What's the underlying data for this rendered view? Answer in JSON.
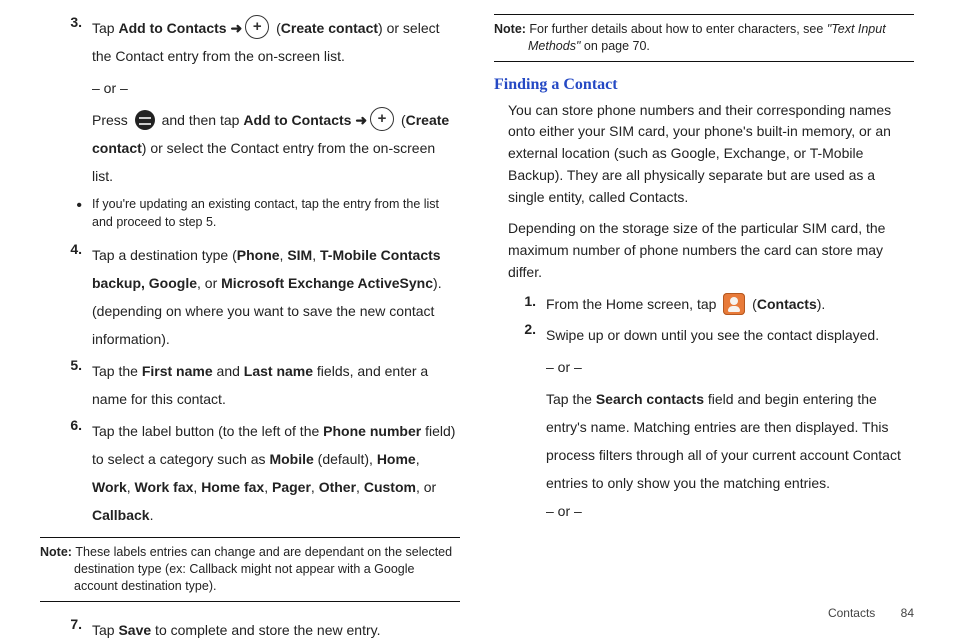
{
  "left": {
    "s3": {
      "num": "3.",
      "a": "Tap ",
      "b": "Add to Contacts",
      "c": " (",
      "d": "Create contact",
      "e": ") or select the Contact entry from the on-screen list.",
      "or": "– or –",
      "p1": "Press ",
      "p2": " and then tap ",
      "p3": "Add to Contacts",
      "p4": " (",
      "p5": "Create contact",
      "p6": ") or select the Contact entry from the on-screen list."
    },
    "bullet": "If you're updating an existing contact, tap the entry from the list and proceed to step 5.",
    "s4": {
      "num": "4.",
      "a": "Tap a destination type (",
      "b": "Phone",
      "c": ", ",
      "d": "SIM",
      "e": ", ",
      "f": "T-Mobile Contacts backup, Google",
      "g": ", or ",
      "h": "Microsoft Exchange ActiveSync",
      "i": "). (depending on where you want to save the new contact information)."
    },
    "s5": {
      "num": "5.",
      "a": "Tap the ",
      "b": "First name",
      "c": " and ",
      "d": "Last name",
      "e": " fields, and enter a name for this contact."
    },
    "s6": {
      "num": "6.",
      "a": "Tap the label button (to the left of the ",
      "b": "Phone number",
      "c": " field) to select a category such as ",
      "d": "Mobile",
      "e": " (default), ",
      "f": "Home",
      "g": ", ",
      "h": "Work",
      "i": ", ",
      "j": "Work fax",
      "k": ", ",
      "l": "Home fax",
      "m": ", ",
      "n": "Pager",
      "o": ", ",
      "p": "Other",
      "q": ", ",
      "r": "Custom",
      "s": ", or ",
      "t": "Callback",
      "u": "."
    },
    "note": {
      "label": "Note: ",
      "text": "These labels entries can change and are dependant on the selected destination type (ex: Callback might not appear with a Google account destination type)."
    },
    "s7": {
      "num": "7.",
      "a": "Tap ",
      "b": "Save",
      "c": " to complete and store the new entry."
    }
  },
  "right": {
    "note": {
      "label": "Note: ",
      "a": "For further details about how to enter characters, see ",
      "b": "\"Text Input Methods\"",
      "c": " on page 70."
    },
    "heading": "Finding a Contact",
    "p1": "You can store phone numbers and their corresponding names onto either your SIM card, your phone's built-in memory, or an external location (such as Google, Exchange, or T-Mobile Backup). They are all physically separate but are used as a single entity, called Contacts.",
    "p2": "Depending on the storage size of the particular SIM card, the maximum number of phone numbers the card can store may differ.",
    "s1": {
      "num": "1.",
      "a": "From the Home screen, tap ",
      "b": " (",
      "c": "Contacts",
      "d": ")."
    },
    "s2": {
      "num": "2.",
      "a": "Swipe up or down until you see the contact displayed.",
      "or": "– or –",
      "b1": "Tap the ",
      "b2": "Search contacts",
      "b3": " field and begin entering the entry's name. Matching entries are then displayed. This process filters through all of your current account Contact entries to only show you the matching entries.",
      "or2": "– or –"
    }
  },
  "footer": {
    "section": "Contacts",
    "page": "84"
  }
}
